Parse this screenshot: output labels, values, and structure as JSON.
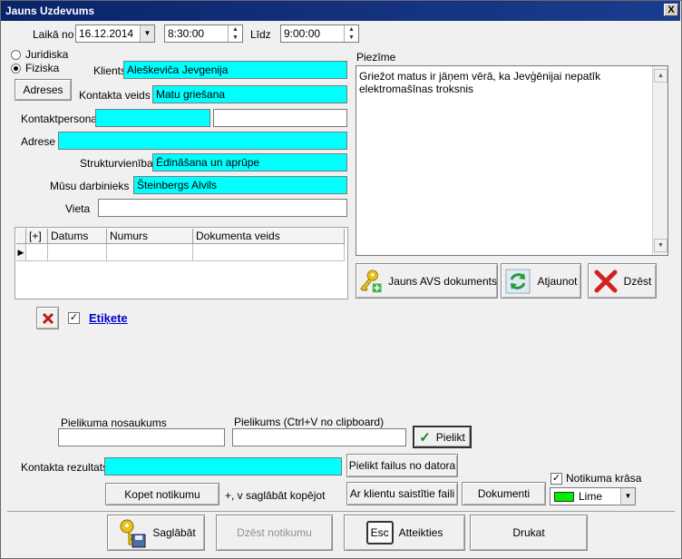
{
  "window": {
    "title": "Jauns Uzdevums",
    "close_label": "X"
  },
  "time": {
    "from_label": "Laikā no",
    "date": "16.12.2014",
    "start": "8:30:00",
    "until_label": "Līdz",
    "end": "9:00:00"
  },
  "client_type": {
    "legal": "Juridiska",
    "physical": "Fiziska"
  },
  "form": {
    "client_label": "Klients",
    "client_value": "Aleškeviča Jevgenija",
    "addresses_button": "Adreses",
    "contact_type_label": "Kontakta veids",
    "contact_type_value": "Matu griešana",
    "contact_person_label": "Kontaktpersona",
    "address_label": "Adrese",
    "structure_label": "Strukturvienība",
    "structure_value": "Ēdināšana un aprūpe",
    "employee_label": "Mūsu darbinieks",
    "employee_value": "Šteinbergs Alvils",
    "place_label": "Vieta"
  },
  "documents_table": {
    "columns": [
      "[+]",
      "Datums",
      "Numurs",
      "Dokumenta veids"
    ],
    "row_marker": "▶"
  },
  "note": {
    "label": "Piezīme",
    "text": "Griežot matus ir jāņem vērā, ka Jevģēnijai nepatīk elektromašīnas troksnis"
  },
  "doc_buttons": {
    "new_doc": "Jauns AVS dokuments",
    "refresh": "Atjaunot",
    "delete": "Dzēst"
  },
  "tag": {
    "label": "Etiķete",
    "remove_icon": "x"
  },
  "attachment": {
    "name_label": "Pielikuma nosaukums",
    "clipboard_label": "Pielikums (Ctrl+V no clipboard)",
    "attach_button": "Pielikt"
  },
  "result": {
    "label": "Kontakta rezultats",
    "from_pc_button": "Pielikt failus no datora",
    "copy_button": "Kopet notikumu",
    "copy_hint": "+, v saglābāt kopējot",
    "client_files_button": "Ar klientu saistītie faili",
    "documents_button": "Dokumenti",
    "color_check_label": "Notikuma krāsa",
    "color_value": "Lime",
    "color_swatch": "#00ee00"
  },
  "footer": {
    "save": "Saglābāt",
    "delete_event": "Dzēst notikumu",
    "cancel": "Atteikties",
    "print": "Drukat",
    "esc_key": "Esc"
  },
  "glyphs": {
    "up": "▲",
    "down": "▼",
    "check": "✓",
    "checkbox_on": "✓"
  }
}
